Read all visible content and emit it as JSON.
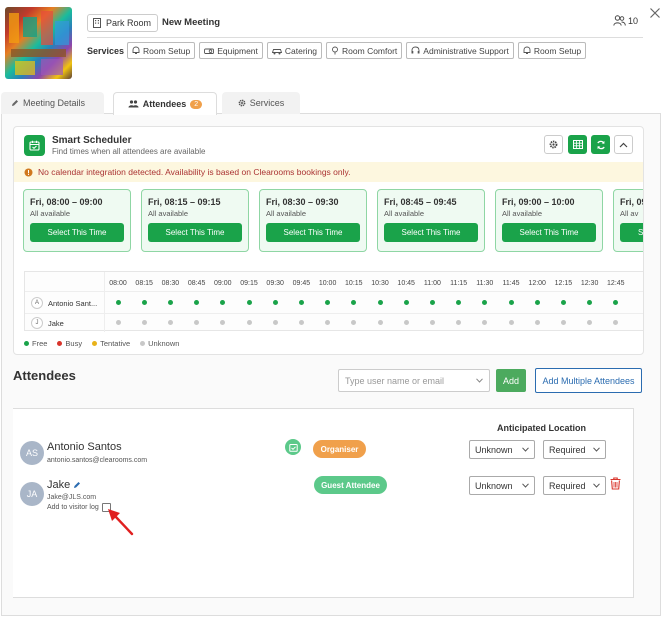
{
  "header": {
    "room": "Park Room",
    "title": "New Meeting",
    "attendee_count": "10",
    "services_label": "Services",
    "services": [
      {
        "label": "Room Setup",
        "icon": "bell-icon"
      },
      {
        "label": "Equipment",
        "icon": "projector-icon"
      },
      {
        "label": "Catering",
        "icon": "car-icon"
      },
      {
        "label": "Room Comfort",
        "icon": "pin-icon"
      },
      {
        "label": "Administrative Support",
        "icon": "headset-icon"
      },
      {
        "label": "Room Setup",
        "icon": "bell-icon"
      }
    ]
  },
  "tabs": [
    {
      "label": "Meeting Details",
      "icon": "pencil-icon"
    },
    {
      "label": "Attendees",
      "icon": "users-icon",
      "badge": "2"
    },
    {
      "label": "Services",
      "icon": "gear-icon"
    }
  ],
  "scheduler": {
    "title": "Smart Scheduler",
    "subtitle": "Find times when all attendees are available",
    "warning": "No calendar integration detected. Availability is based on Clearooms bookings only.",
    "slots": [
      {
        "time": "Fri, 08:00 – 09:00",
        "status": "All available",
        "button": "Select This Time"
      },
      {
        "time": "Fri, 08:15 – 09:15",
        "status": "All available",
        "button": "Select This Time"
      },
      {
        "time": "Fri, 08:30 – 09:30",
        "status": "All available",
        "button": "Select This Time"
      },
      {
        "time": "Fri, 08:45 – 09:45",
        "status": "All available",
        "button": "Select This Time"
      },
      {
        "time": "Fri, 09:00 – 10:00",
        "status": "All available",
        "button": "Select This Time"
      },
      {
        "time": "Fri, 09:1",
        "status": "All av",
        "button": "Se"
      }
    ],
    "times": [
      "08:00",
      "08:15",
      "08:30",
      "08:45",
      "09:00",
      "09:15",
      "09:30",
      "09:45",
      "10:00",
      "10:15",
      "10:30",
      "10:45",
      "11:00",
      "11:15",
      "11:30",
      "11:45",
      "12:00",
      "12:15",
      "12:30",
      "12:45"
    ],
    "people": [
      {
        "initial": "A",
        "name": "Antonio Sant...",
        "status": "free"
      },
      {
        "initial": "J",
        "name": "Jake",
        "status": "unknown"
      }
    ],
    "legend": [
      {
        "label": "Free",
        "color": "#1aa34a"
      },
      {
        "label": "Busy",
        "color": "#d9342b"
      },
      {
        "label": "Tentative",
        "color": "#e8b21a"
      },
      {
        "label": "Unknown",
        "color": "#c8c8c8"
      }
    ]
  },
  "attendees": {
    "title": "Attendees",
    "search_placeholder": "Type user name or email",
    "add_label": "Add",
    "add_multiple_label": "Add Multiple Attendees",
    "location_header": "Anticipated Location",
    "list": [
      {
        "initials": "AS",
        "name": "Antonio Santos",
        "email": "antonio.santos@clearooms.com",
        "role": "Organiser",
        "role_color": "#f0a04b",
        "location": "Unknown",
        "requirement": "Required"
      },
      {
        "initials": "JA",
        "name": "Jake",
        "email": "Jake@JLS.com",
        "role": "Guest Attendee",
        "role_color": "#5cc98a",
        "location": "Unknown",
        "requirement": "Required",
        "visitor_label": "Add to visitor log"
      }
    ]
  }
}
